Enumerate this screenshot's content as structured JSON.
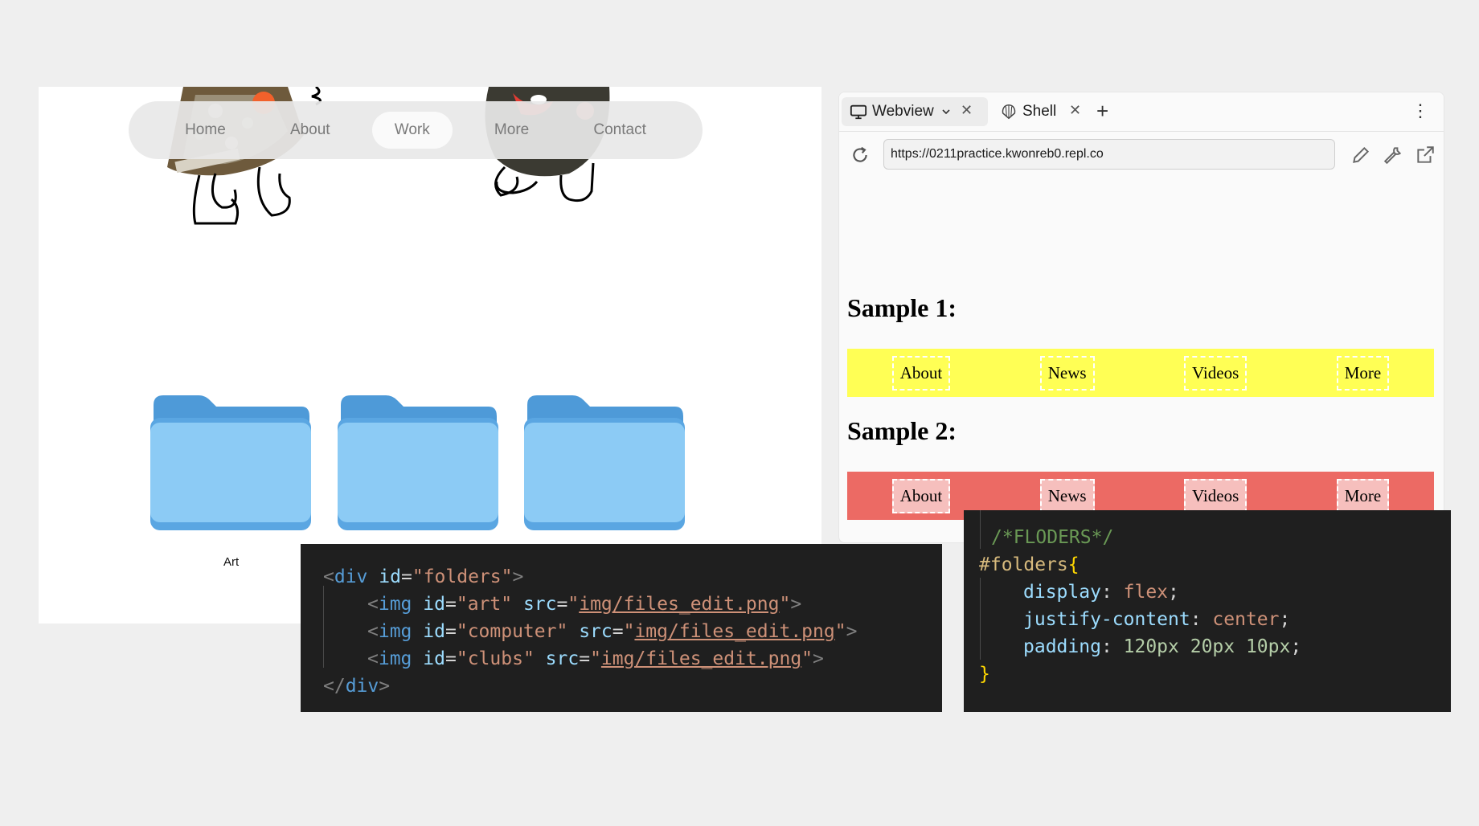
{
  "site": {
    "nav": [
      {
        "label": "Home",
        "active": false
      },
      {
        "label": "About",
        "active": false
      },
      {
        "label": "Work",
        "active": true
      },
      {
        "label": "More",
        "active": false
      },
      {
        "label": "Contact",
        "active": false
      }
    ],
    "folders": [
      {
        "id": "art",
        "label": "Art"
      },
      {
        "id": "computer",
        "label": ""
      },
      {
        "id": "clubs",
        "label": ""
      }
    ],
    "folder_color": "#8ccbf5"
  },
  "webview": {
    "tabs": [
      {
        "label": "Webview",
        "icon": "monitor-icon",
        "has_dropdown": true,
        "active": true
      },
      {
        "label": "Shell",
        "icon": "shell-icon",
        "has_dropdown": false,
        "active": false
      }
    ],
    "url": "https://0211practice.kwonreb0.repl.co",
    "sample1": {
      "title": "Sample 1:",
      "links": [
        "About",
        "News",
        "Videos",
        "More"
      ],
      "bar_color": "#ffff55"
    },
    "sample2": {
      "title": "Sample 2:",
      "links": [
        "About",
        "News",
        "Videos",
        "More"
      ],
      "bar_color": "#ec6a64"
    }
  },
  "html_code": {
    "lines": [
      "<div id=\"folders\">",
      "    <img id=\"art\" src=\"img/files_edit.png\">",
      "    <img id=\"computer\" src=\"img/files_edit.png\">",
      "    <img id=\"clubs\" src=\"img/files_edit.png\">",
      "</div>"
    ],
    "tokens": {
      "open_lt": "<",
      "div": "div",
      "gt": ">",
      "close_open": "</",
      "img": "img",
      "id_attr": "id",
      "src_attr": "src",
      "eq": "=",
      "q": "\"",
      "folders_val": "folders",
      "img_ids": [
        "art",
        "computer",
        "clubs"
      ],
      "src_val": "img/files_edit.png"
    }
  },
  "css_code": {
    "comment": "/*FLODERS*/",
    "selector": "#folders",
    "open_brace": "{",
    "close_brace": "}",
    "rules": [
      {
        "prop": "display",
        "value": "flex"
      },
      {
        "prop": "justify-content",
        "value": "center"
      },
      {
        "prop": "padding",
        "value": "120px 20px 10px"
      }
    ]
  }
}
